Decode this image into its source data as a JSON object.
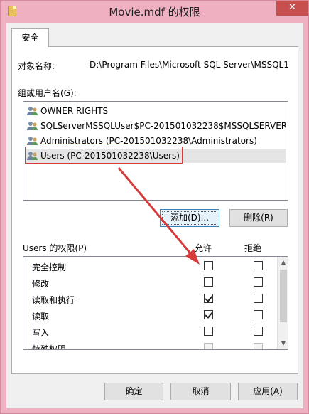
{
  "window": {
    "title": "Movie.mdf 的权限",
    "close_label": "✕"
  },
  "tabs": [
    {
      "label": "安全"
    }
  ],
  "object": {
    "label": "对象名称:",
    "value": "D:\\Program Files\\Microsoft SQL Server\\MSSQL1"
  },
  "groups": {
    "label": "组或用户名(G):",
    "items": [
      {
        "label": "OWNER RIGHTS"
      },
      {
        "label": "SQLServerMSSQLUser$PC-201501032238$MSSQLSERVER..."
      },
      {
        "label": "Administrators (PC-201501032238\\Administrators)"
      },
      {
        "label": "Users (PC-201501032238\\Users)"
      }
    ],
    "selected_index": 3
  },
  "group_buttons": {
    "add_label": "添加(D)...",
    "remove_label": "删除(R)"
  },
  "permissions": {
    "label": "Users 的权限(P)",
    "allow_header": "允许",
    "deny_header": "拒绝",
    "rows": [
      {
        "name": "完全控制",
        "allow": false,
        "deny": false
      },
      {
        "name": "修改",
        "allow": false,
        "deny": false
      },
      {
        "name": "读取和执行",
        "allow": true,
        "deny": false
      },
      {
        "name": "读取",
        "allow": true,
        "deny": false
      },
      {
        "name": "写入",
        "allow": false,
        "deny": false
      },
      {
        "name": "特殊权限",
        "allow": false,
        "deny": false
      }
    ]
  },
  "dialog_buttons": {
    "ok_label": "确定",
    "cancel_label": "取消",
    "apply_label": "应用(A)"
  },
  "colors": {
    "annotation_red": "#d73a3a",
    "titlebar": "#efb1c2",
    "close": "#c7504e"
  }
}
